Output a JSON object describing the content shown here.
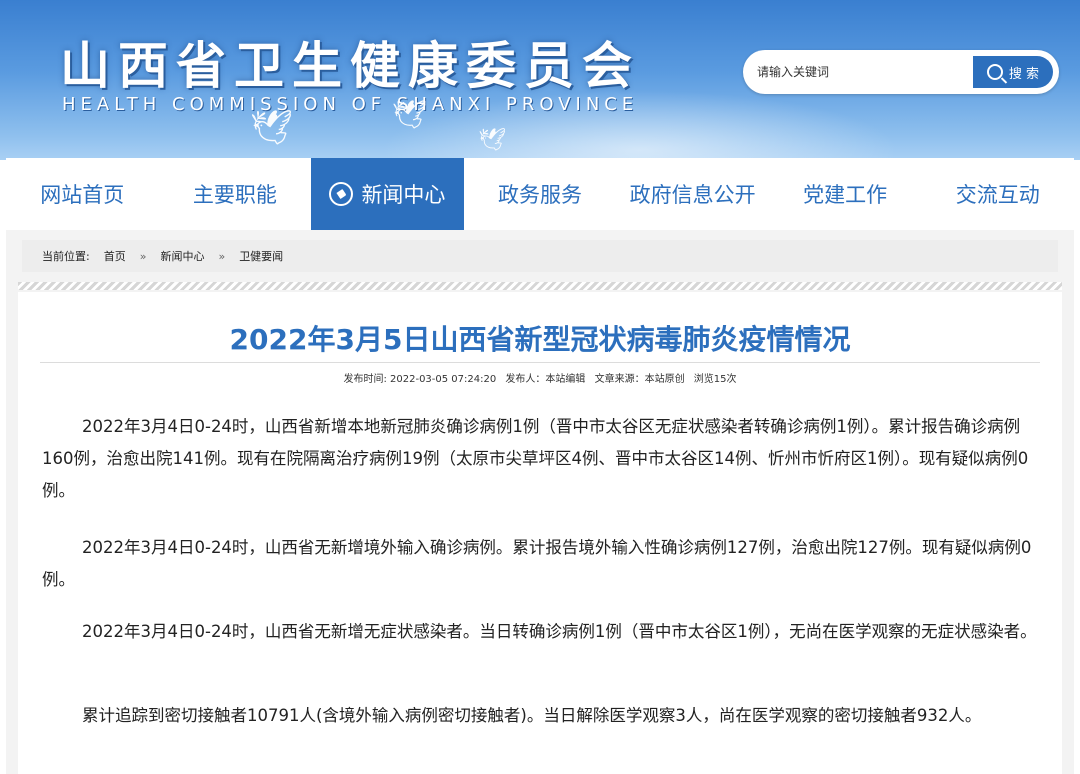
{
  "header": {
    "title": "山西省卫生健康委员会",
    "subtitle": "HEALTH COMMISSION OF SHANXI PROVINCE"
  },
  "search": {
    "placeholder": "请输入关键词",
    "button_label": "搜 索"
  },
  "nav": {
    "items": [
      {
        "label": "网站首页"
      },
      {
        "label": "主要职能"
      },
      {
        "label": "新闻中心",
        "active": true
      },
      {
        "label": "政务服务"
      },
      {
        "label": "政府信息公开"
      },
      {
        "label": "党建工作"
      },
      {
        "label": "交流互动"
      }
    ]
  },
  "breadcrumb": {
    "prefix": "当前位置:",
    "items": [
      "首页",
      "新闻中心",
      "卫健要闻"
    ],
    "separator": "»"
  },
  "article": {
    "title": "2022年3月5日山西省新型冠状病毒肺炎疫情情况",
    "meta": {
      "publish_time": "发布时间: 2022-03-05 07:24:20",
      "publisher": "发布人：本站编辑",
      "source": "文章来源：本站原创",
      "views": "浏览15次"
    },
    "paragraphs": [
      "2022年3月4日0-24时，山西省新增本地新冠肺炎确诊病例1例（晋中市太谷区无症状感染者转确诊病例1例）。累计报告确诊病例160例，治愈出院141例。现有在院隔离治疗病例19例（太原市尖草坪区4例、晋中市太谷区14例、忻州市忻府区1例）。现有疑似病例0例。",
      "2022年3月4日0-24时，山西省无新增境外输入确诊病例。累计报告境外输入性确诊病例127例，治愈出院127例。现有疑似病例0例。",
      "2022年3月4日0-24时，山西省无新增无症状感染者。当日转确诊病例1例（晋中市太谷区1例），无尚在医学观察的无症状感染者。",
      "累计追踪到密切接触者10791人(含境外输入病例密切接触者)。当日解除医学观察3人，尚在医学观察的密切接触者932人。"
    ]
  },
  "colors": {
    "brand_blue": "#2c6fbd",
    "banner_top": "#3a7fd0"
  }
}
